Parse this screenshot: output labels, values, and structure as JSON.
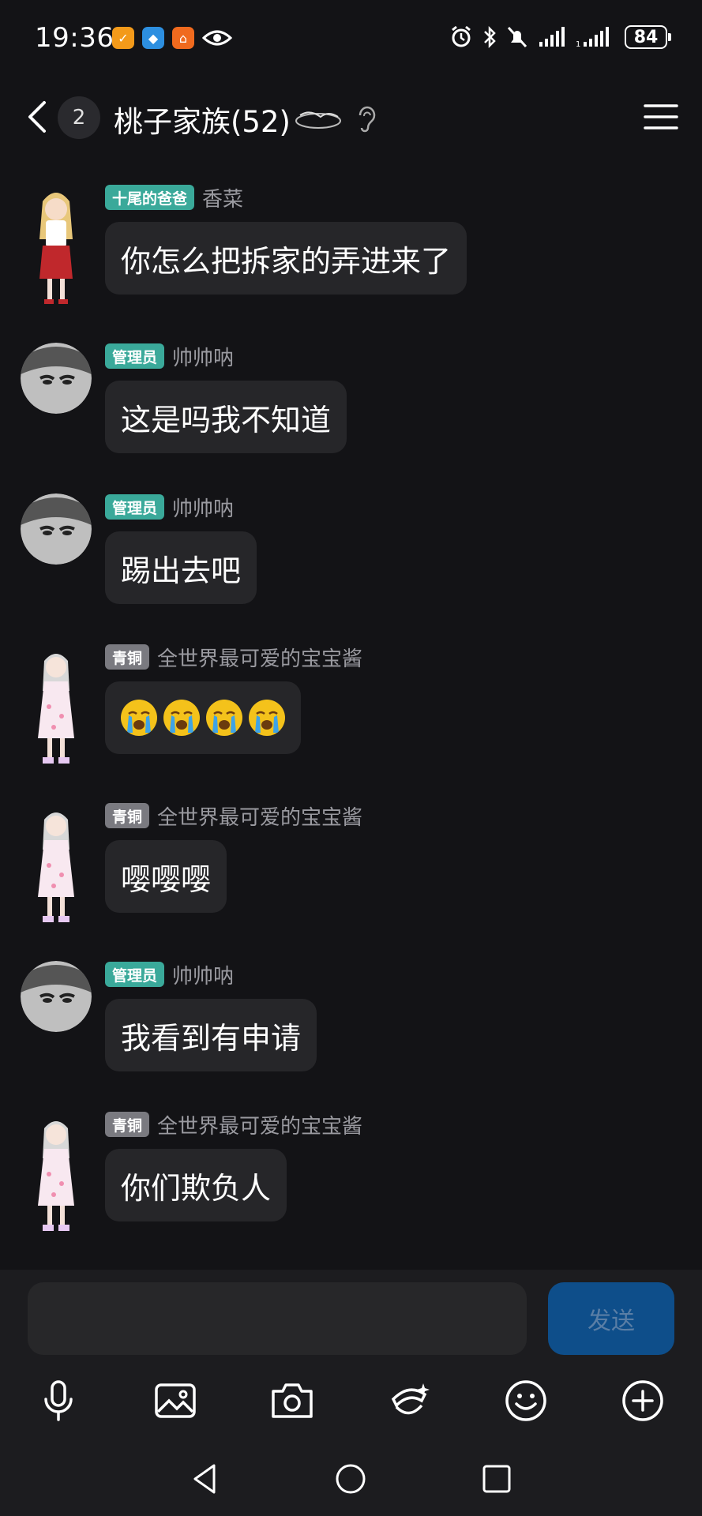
{
  "status_bar": {
    "time": "19:36",
    "battery": "84"
  },
  "header": {
    "unread_count": "2",
    "group_name": "桃子家族(52)"
  },
  "messages": [
    {
      "role": "十尾的爸爸",
      "role_color": "teal",
      "sender": "香菜",
      "text": "你怎么把拆家的弄进来了"
    },
    {
      "role": "管理员",
      "role_color": "teal",
      "sender": "帅帅呐",
      "text": "这是吗我不知道"
    },
    {
      "role": "管理员",
      "role_color": "teal",
      "sender": "帅帅呐",
      "text": "踢出去吧"
    },
    {
      "role": "青铜",
      "role_color": "gray",
      "sender": "全世界最可爱的宝宝酱",
      "emoji": "loudly-crying-face",
      "emoji_count": 4
    },
    {
      "role": "青铜",
      "role_color": "gray",
      "sender": "全世界最可爱的宝宝酱",
      "text": "嘤嘤嘤"
    },
    {
      "role": "管理员",
      "role_color": "teal",
      "sender": "帅帅呐",
      "text": "我看到有申请"
    },
    {
      "role": "青铜",
      "role_color": "gray",
      "sender": "全世界最可爱的宝宝酱",
      "text": "你们欺负人"
    }
  ],
  "composer": {
    "value": "",
    "send_label": "发送"
  },
  "colors": {
    "background": "#131316",
    "bubble": "#262629",
    "badge_teal": "#3aa99a",
    "badge_gray": "#7a7a80",
    "send_button": "#0e4e8a"
  },
  "icons": [
    "microphone-icon",
    "image-icon",
    "camera-icon",
    "magic-icon",
    "emoji-icon",
    "plus-circle-icon",
    "back-triangle-icon",
    "home-circle-icon",
    "recent-square-icon"
  ]
}
